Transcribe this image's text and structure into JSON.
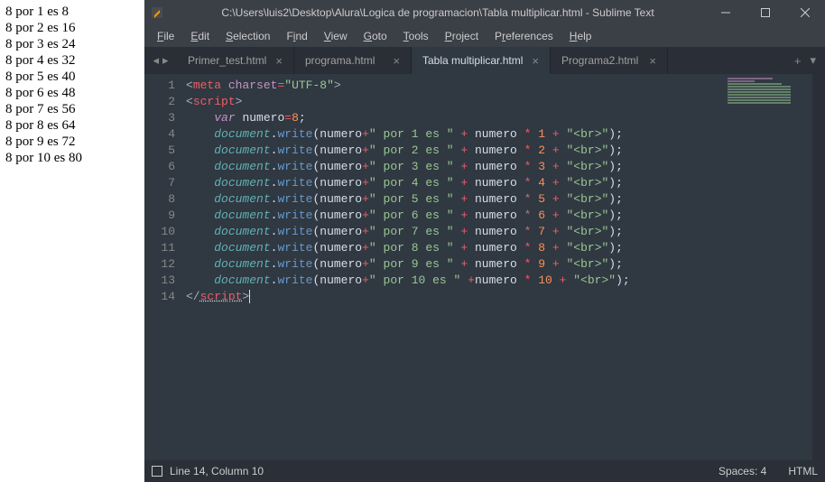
{
  "browser_output": [
    "8 por 1 es 8",
    "8 por 2 es 16",
    "8 por 3 es 24",
    "8 por 4 es 32",
    "8 por 5 es 40",
    "8 por 6 es 48",
    "8 por 7 es 56",
    "8 por 8 es 64",
    "8 por 9 es 72",
    "8 por 10 es 80"
  ],
  "window": {
    "title": "C:\\Users\\luis2\\Desktop\\Alura\\Logica de programacion\\Tabla multiplicar.html - Sublime Text"
  },
  "menu": {
    "file": "File",
    "edit": "Edit",
    "selection": "Selection",
    "find": "Find",
    "view": "View",
    "goto": "Goto",
    "tools": "Tools",
    "project": "Project",
    "preferences": "Preferences",
    "help": "Help"
  },
  "tabs": [
    {
      "label": "Primer_test.html",
      "active": false
    },
    {
      "label": "programa.html",
      "active": false
    },
    {
      "label": "Tabla multiplicar.html",
      "active": true
    },
    {
      "label": "Programa2.html",
      "active": false
    }
  ],
  "line_numbers": [
    "1",
    "2",
    "3",
    "4",
    "5",
    "6",
    "7",
    "8",
    "9",
    "10",
    "11",
    "12",
    "13",
    "14"
  ],
  "code_data": {
    "var_number": "8",
    "string_parts": [
      " por 1 es ",
      " por 2 es ",
      " por 3 es ",
      " por 4 es ",
      " por 5 es ",
      " por 6 es ",
      " por 7 es ",
      " por 8 es ",
      " por 9 es ",
      " por 10 es "
    ],
    "multipliers": [
      "1",
      "2",
      "3",
      "4",
      "5",
      "6",
      "7",
      "8",
      "9",
      "10"
    ]
  },
  "status": {
    "cursor": "Line 14, Column 10",
    "spaces": "Spaces: 4",
    "syntax": "HTML"
  }
}
